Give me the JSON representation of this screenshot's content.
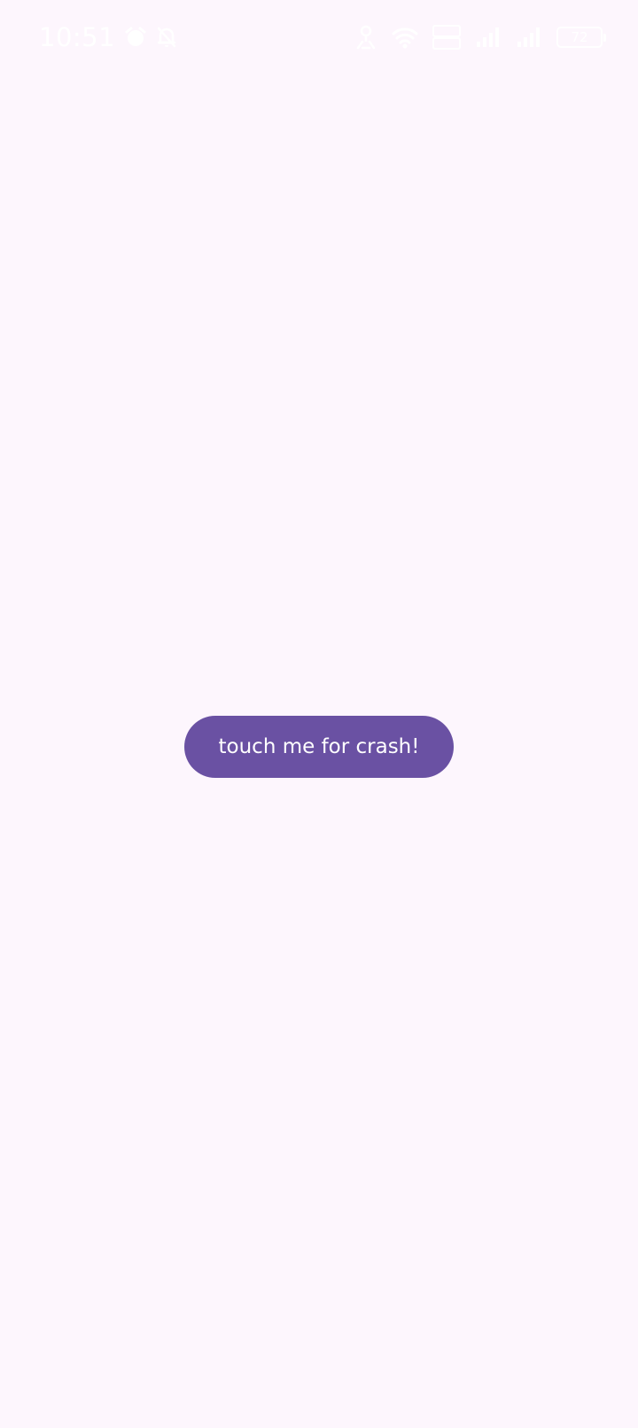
{
  "status_bar": {
    "time": "10:51",
    "battery_level": "72",
    "icons": [
      "alarm-icon",
      "notifications-off-icon",
      "location-icon",
      "wifi-icon",
      "hd-icon",
      "signal-icon",
      "signal-icon",
      "battery-icon"
    ]
  },
  "main": {
    "crash_button_label": "touch me for crash!"
  },
  "colors": {
    "background": "#fdf6fd",
    "button": "#6a51a3",
    "button_text": "#ffffff",
    "status_icons": "#ffffff"
  }
}
